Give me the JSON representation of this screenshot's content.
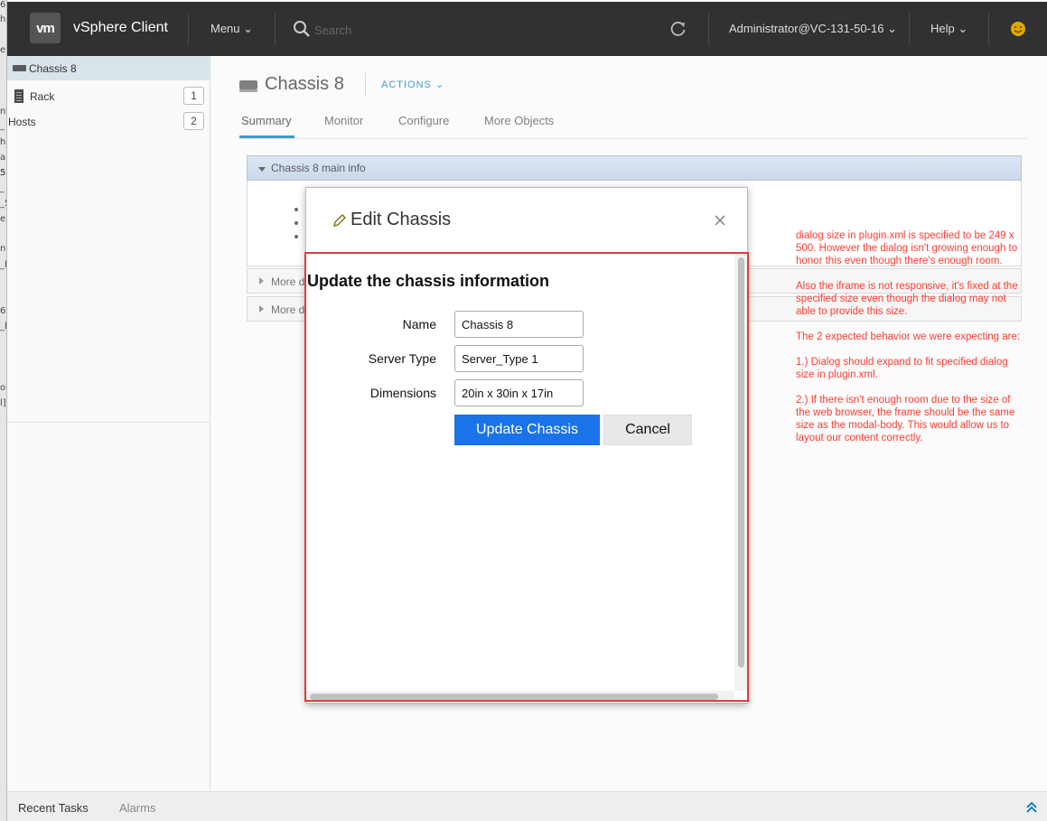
{
  "background_window": {
    "fragments": [
      "6",
      "h",
      "e",
      "nt",
      "_",
      "hi",
      "ab",
      "5",
      "_",
      "_5",
      "e",
      "n",
      "_h",
      "6",
      "_h",
      "ol",
      "l]",
      "5"
    ]
  },
  "header": {
    "logo": "vm",
    "app_title": "vSphere Client",
    "menu_label": "Menu",
    "search_placeholder": "Search",
    "user_label": "Administrator@VC-131-50-16",
    "help_label": "Help"
  },
  "navigator": {
    "selected": "Chassis 8",
    "items": [
      {
        "label": "Rack",
        "count": "1"
      },
      {
        "label": "Hosts",
        "count": "2"
      }
    ]
  },
  "main": {
    "title": "Chassis 8",
    "actions_label": "ACTIONS",
    "tabs": [
      {
        "label": "Summary"
      },
      {
        "label": "Monitor"
      },
      {
        "label": "Configure"
      },
      {
        "label": "More Objects"
      }
    ],
    "portlet_title": "Chassis 8 main info",
    "more_portlets": [
      "More d",
      "More d"
    ]
  },
  "modal": {
    "title": "Edit Chassis",
    "heading": "Update the chassis information",
    "fields": [
      {
        "label": "Name",
        "value": "Chassis 8"
      },
      {
        "label": "Server Type",
        "value": "Server_Type 1"
      },
      {
        "label": "Dimensions",
        "value": "20in x 30in x 17in"
      }
    ],
    "update_button": "Update Chassis",
    "cancel_button": "Cancel"
  },
  "annotation": {
    "paragraphs": [
      "dialog size in plugin.xml is specified to be 249 x 500. However the dialog isn't growing enough to honor this even though there's enough room.",
      "Also the iframe is not responsive, it's fixed at the specified size even though the dialog may not able to provide this size.",
      "The 2 expected behavior we were expecting are:",
      "1.) Dialog should expand to fit specified dialog size in plugin.xml.",
      "2.) If there isn't enough room due to the size of the web browser, the frame should be the same size as the modal-body.  This would allow us to layout our content correctly."
    ],
    "color": "#ff3b30"
  },
  "bottom_bar": {
    "tabs": [
      {
        "label": "Recent Tasks"
      },
      {
        "label": "Alarms"
      }
    ]
  },
  "colors": {
    "accent": "#0079b8",
    "primary_button": "#1a73e8",
    "frame_border": "#e53935",
    "header_bg": "#313131"
  }
}
